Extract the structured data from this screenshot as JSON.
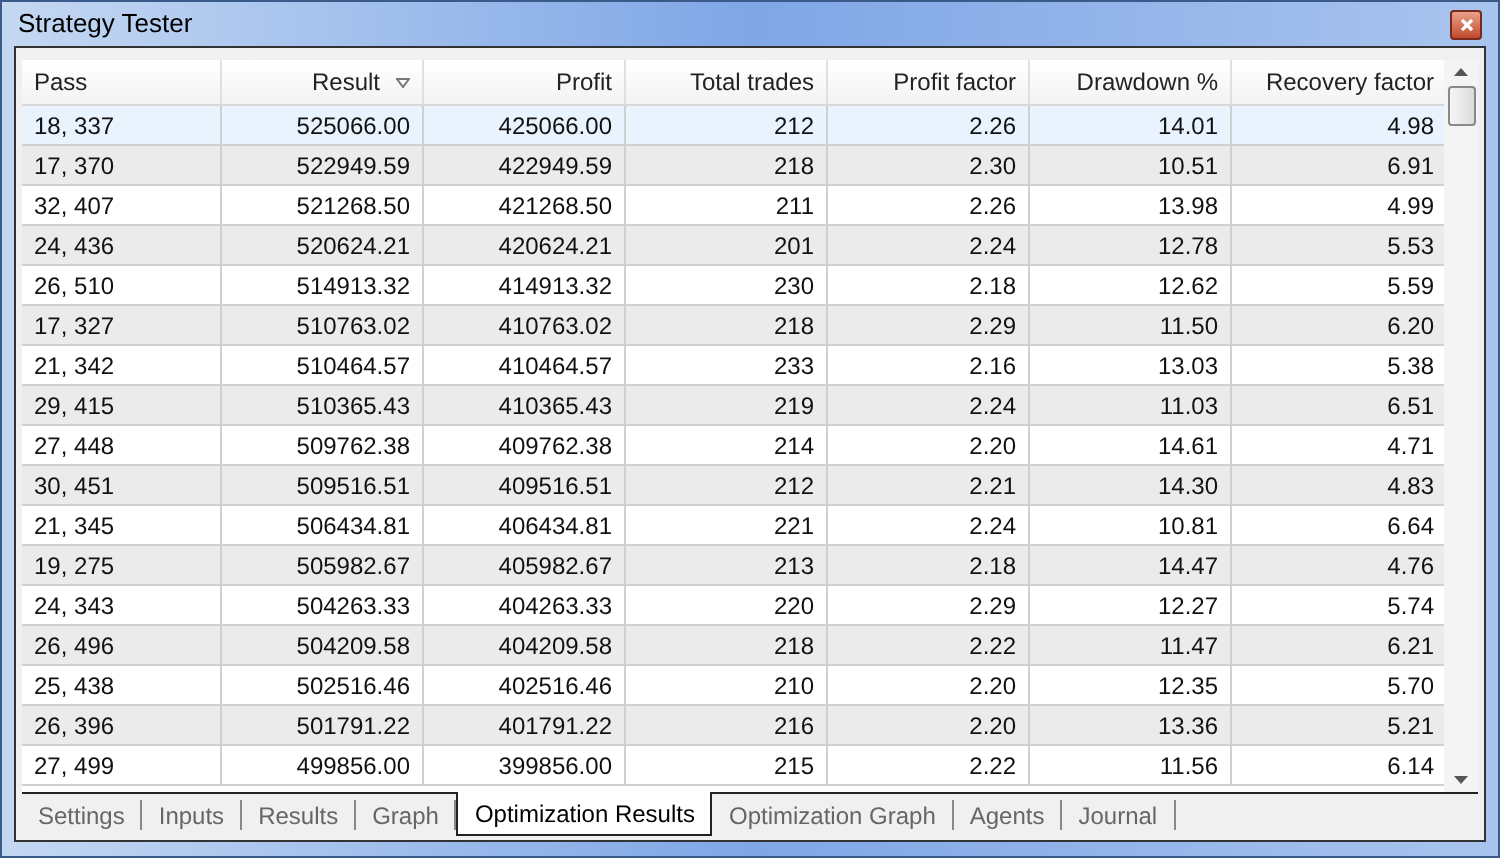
{
  "window": {
    "title": "Strategy Tester"
  },
  "table": {
    "columns": [
      {
        "label": "Pass",
        "sorted": false
      },
      {
        "label": "Result",
        "sorted": true
      },
      {
        "label": "Profit",
        "sorted": false
      },
      {
        "label": "Total trades",
        "sorted": false
      },
      {
        "label": "Profit factor",
        "sorted": false
      },
      {
        "label": "Drawdown %",
        "sorted": false
      },
      {
        "label": "Recovery factor",
        "sorted": false
      }
    ],
    "rows": [
      {
        "selected": true,
        "cells": [
          "18, 337",
          "525066.00",
          "425066.00",
          "212",
          "2.26",
          "14.01",
          "4.98"
        ]
      },
      {
        "selected": false,
        "cells": [
          "17, 370",
          "522949.59",
          "422949.59",
          "218",
          "2.30",
          "10.51",
          "6.91"
        ]
      },
      {
        "selected": false,
        "cells": [
          "32, 407",
          "521268.50",
          "421268.50",
          "211",
          "2.26",
          "13.98",
          "4.99"
        ]
      },
      {
        "selected": false,
        "cells": [
          "24, 436",
          "520624.21",
          "420624.21",
          "201",
          "2.24",
          "12.78",
          "5.53"
        ]
      },
      {
        "selected": false,
        "cells": [
          "26, 510",
          "514913.32",
          "414913.32",
          "230",
          "2.18",
          "12.62",
          "5.59"
        ]
      },
      {
        "selected": false,
        "cells": [
          "17, 327",
          "510763.02",
          "410763.02",
          "218",
          "2.29",
          "11.50",
          "6.20"
        ]
      },
      {
        "selected": false,
        "cells": [
          "21, 342",
          "510464.57",
          "410464.57",
          "233",
          "2.16",
          "13.03",
          "5.38"
        ]
      },
      {
        "selected": false,
        "cells": [
          "29, 415",
          "510365.43",
          "410365.43",
          "219",
          "2.24",
          "11.03",
          "6.51"
        ]
      },
      {
        "selected": false,
        "cells": [
          "27, 448",
          "509762.38",
          "409762.38",
          "214",
          "2.20",
          "14.61",
          "4.71"
        ]
      },
      {
        "selected": false,
        "cells": [
          "30, 451",
          "509516.51",
          "409516.51",
          "212",
          "2.21",
          "14.30",
          "4.83"
        ]
      },
      {
        "selected": false,
        "cells": [
          "21, 345",
          "506434.81",
          "406434.81",
          "221",
          "2.24",
          "10.81",
          "6.64"
        ]
      },
      {
        "selected": false,
        "cells": [
          "19, 275",
          "505982.67",
          "405982.67",
          "213",
          "2.18",
          "14.47",
          "4.76"
        ]
      },
      {
        "selected": false,
        "cells": [
          "24, 343",
          "504263.33",
          "404263.33",
          "220",
          "2.29",
          "12.27",
          "5.74"
        ]
      },
      {
        "selected": false,
        "cells": [
          "26, 496",
          "504209.58",
          "404209.58",
          "218",
          "2.22",
          "11.47",
          "6.21"
        ]
      },
      {
        "selected": false,
        "cells": [
          "25, 438",
          "502516.46",
          "402516.46",
          "210",
          "2.20",
          "12.35",
          "5.70"
        ]
      },
      {
        "selected": false,
        "cells": [
          "26, 396",
          "501791.22",
          "401791.22",
          "216",
          "2.20",
          "13.36",
          "5.21"
        ]
      },
      {
        "selected": false,
        "cells": [
          "27, 499",
          "499856.00",
          "399856.00",
          "215",
          "2.22",
          "11.56",
          "6.14"
        ]
      }
    ]
  },
  "tabs": [
    {
      "label": "Settings",
      "selected": false
    },
    {
      "label": "Inputs",
      "selected": false
    },
    {
      "label": "Results",
      "selected": false
    },
    {
      "label": "Graph",
      "selected": false
    },
    {
      "label": "Optimization Results",
      "selected": true
    },
    {
      "label": "Optimization Graph",
      "selected": false
    },
    {
      "label": "Agents",
      "selected": false
    },
    {
      "label": "Journal",
      "selected": false
    }
  ]
}
